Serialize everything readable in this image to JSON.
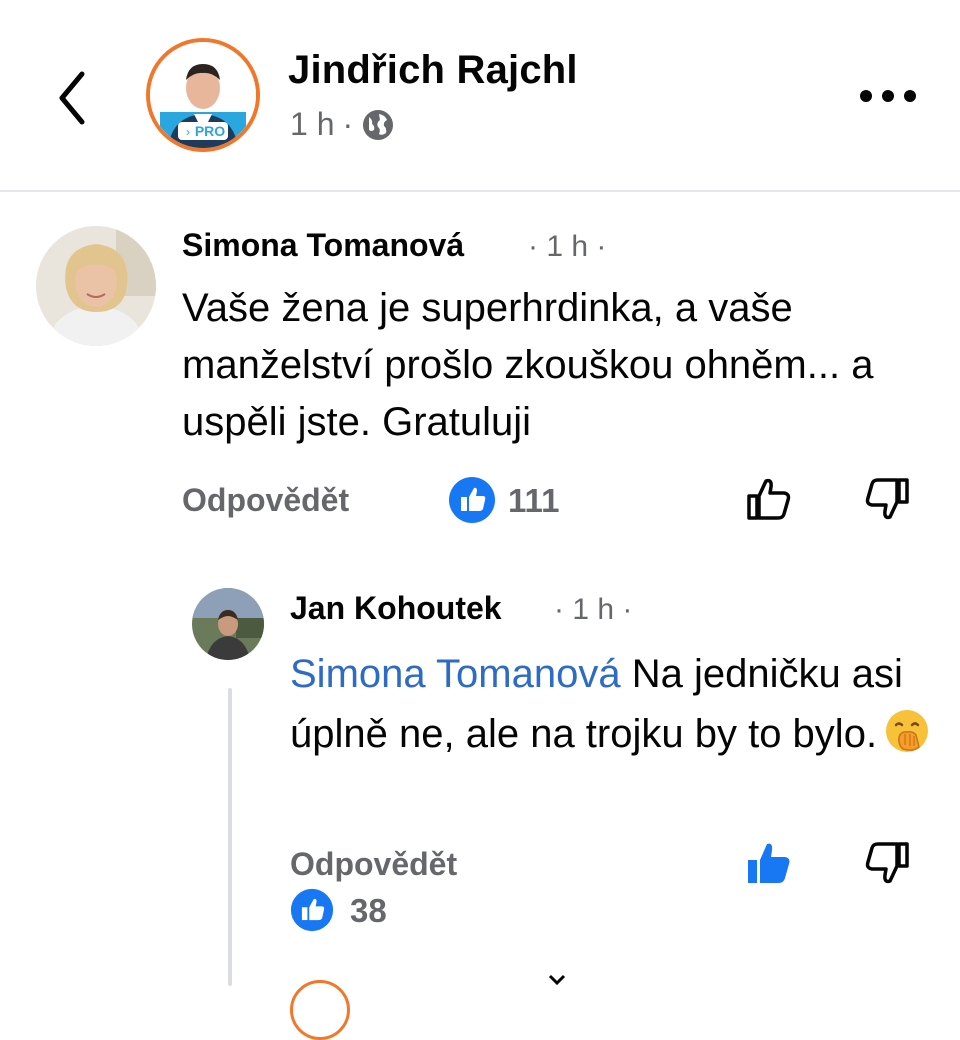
{
  "header": {
    "page_name": "Jindřich Rajchl",
    "time": "1 h",
    "separator": "·",
    "avatar_badge": "PRO",
    "icons": {
      "back": "chevron-left-icon",
      "privacy": "globe-icon",
      "more": "more-horizontal-icon"
    }
  },
  "comments": [
    {
      "author": "Simona Tomanová",
      "time": "· 1 h ·",
      "text": "Vaše žena je superhrdinka, a vaše manželství prošlo zkouškou ohněm... a uspěli jste. Gratuluji",
      "reply_label": "Odpovědět",
      "like_count": "111",
      "icons": {
        "like_badge": "like-badge-icon",
        "like": "thumbs-up-outline-icon",
        "dislike": "thumbs-down-outline-icon"
      }
    },
    {
      "author": "Jan Kohoutek",
      "time": "· 1 h ·",
      "mention": "Simona Tomanová",
      "text": " Na jedničku asi úplně ne, ale na trojku by to bylo.",
      "emoji": "face-with-hand-over-mouth",
      "reply_label": "Odpovědět",
      "like_count": "38",
      "liked_by_viewer": true,
      "icons": {
        "like_badge": "like-badge-icon",
        "like": "thumbs-up-filled-icon",
        "dislike": "thumbs-down-outline-icon"
      }
    }
  ],
  "colors": {
    "accent": "#1877f2",
    "mention": "#2d6bc4",
    "secondary_text": "#65676b",
    "avatar_ring": "#f0772b",
    "pro_badge": "#2aa7df"
  }
}
